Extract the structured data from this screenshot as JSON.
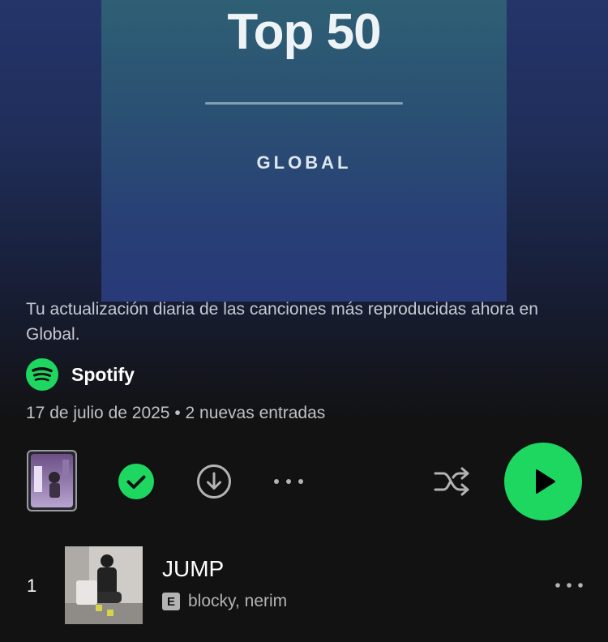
{
  "cover": {
    "title": "Top 50",
    "subtitle": "GLOBAL"
  },
  "playlist": {
    "description": "Tu actualización diaria de las canciones más reproducidas ahora en Global.",
    "owner": "Spotify",
    "meta": "17 de julio de 2025 • 2 nuevas entradas"
  },
  "controls": {
    "saved": true,
    "more_icon": "more-horizontal-icon",
    "shuffle_icon": "shuffle-icon",
    "play_icon": "play-icon",
    "download_icon": "download-icon",
    "check_icon": "check-icon"
  },
  "colors": {
    "accent": "#1ed760",
    "background": "#121212",
    "secondary_text": "#b3b3b3"
  },
  "tracks": [
    {
      "number": "1",
      "title": "JUMP",
      "explicit_label": "E",
      "artists": "blocky, nerim"
    }
  ]
}
